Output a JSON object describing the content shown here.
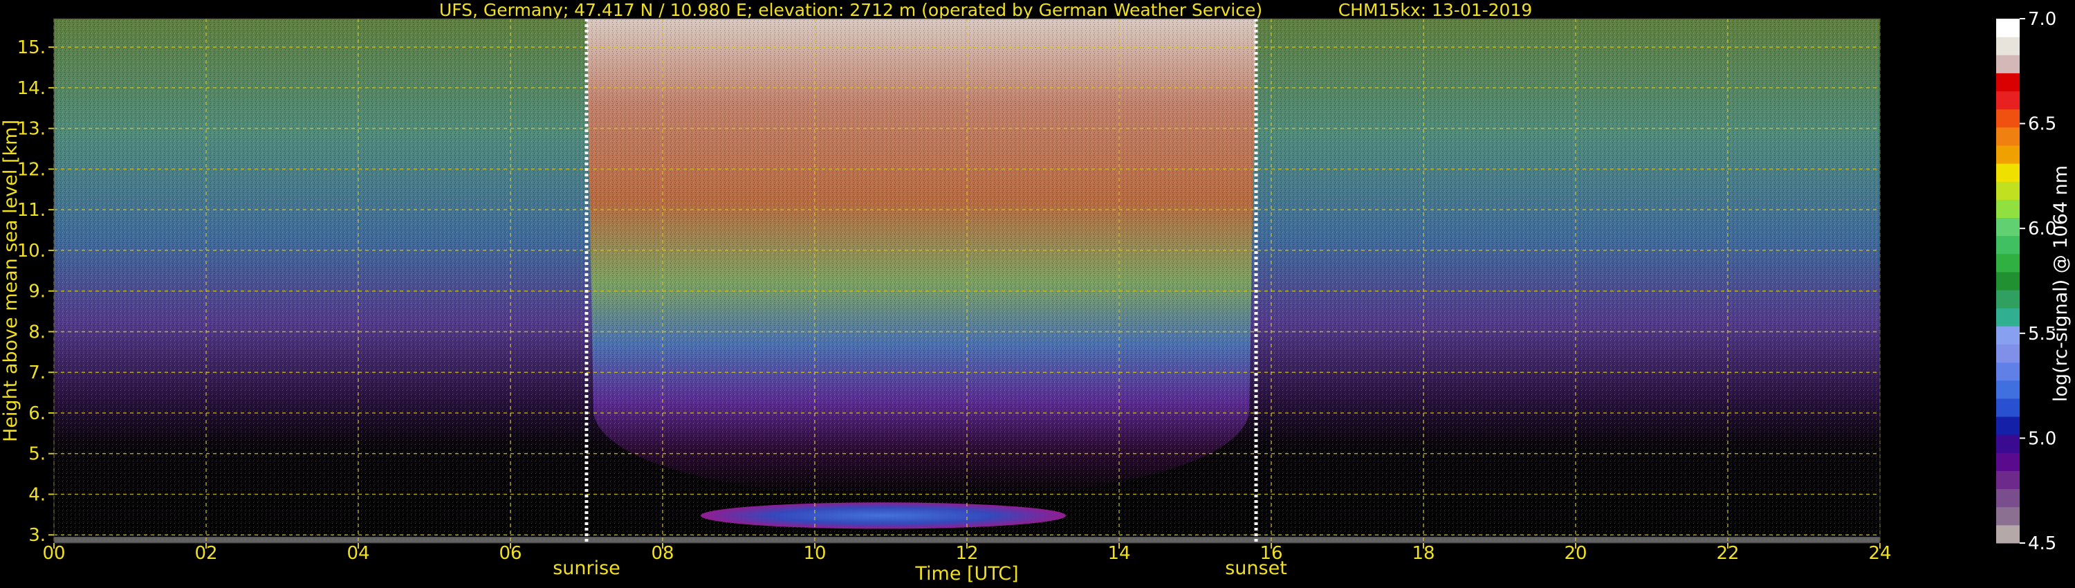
{
  "chart_data": {
    "type": "heatmap",
    "title": "UFS, Germany; 47.417 N / 10.980 E; elevation: 2712 m  (operated by German Weather Service)",
    "subtitle": "CHM15kx: 13-01-2019",
    "xlabel": "Time [UTC]",
    "ylabel": "Height above mean sea level [km]",
    "xlim": [
      0,
      24
    ],
    "ylim": [
      2.8,
      15.7
    ],
    "x_ticks": [
      "00",
      "02",
      "04",
      "06",
      "08",
      "10",
      "12",
      "14",
      "16",
      "18",
      "20",
      "22",
      "24"
    ],
    "y_ticks": [
      "3.",
      "4.",
      "5.",
      "6.",
      "7.",
      "8.",
      "9.",
      "10.",
      "11.",
      "12.",
      "13.",
      "14.",
      "15."
    ],
    "grid": true,
    "markers": [
      {
        "label": "sunrise",
        "time": 7.0
      },
      {
        "label": "sunset",
        "time": 15.8
      }
    ],
    "colorbar": {
      "label": "log(rc-signal) @ 1064 nm",
      "range": [
        4.5,
        7.0
      ],
      "ticks": [
        "4.5",
        "5.0",
        "5.5",
        "6.0",
        "6.5",
        "7.0"
      ],
      "colors": [
        "#b4a8a8",
        "#8c7092",
        "#7a4e8c",
        "#6e2a8a",
        "#5a0a8c",
        "#3a0a90",
        "#1420a8",
        "#2850d0",
        "#4070e0",
        "#6080e8",
        "#8090e8",
        "#88a0f0",
        "#30b090",
        "#30a060",
        "#209030",
        "#30b040",
        "#40c060",
        "#60d070",
        "#90e040",
        "#c0e020",
        "#f0e000",
        "#f0a000",
        "#f08010",
        "#f05010",
        "#e82020",
        "#d80000",
        "#d4b8b8",
        "#e8e4dc",
        "#ffffff"
      ]
    },
    "profile": {
      "time": [
        0,
        2,
        4,
        6,
        7,
        8,
        10,
        12,
        14,
        15.8,
        18,
        20,
        22,
        24
      ],
      "background_top_color": [
        "#6a8a4a",
        "#6a8a4a",
        "#6a8a4a",
        "#6a8a4a",
        "#b06040",
        "#c08070",
        "#d8c8c0",
        "#d8c8c0",
        "#c08070",
        "#6a8a4a",
        "#6a8a4a",
        "#6a8a4a",
        "#6a8a4a",
        "#6a8a4a"
      ]
    },
    "boundary_layer": {
      "time_range": [
        8.5,
        13.3
      ],
      "height_km": [
        3.15,
        3.8
      ]
    }
  }
}
